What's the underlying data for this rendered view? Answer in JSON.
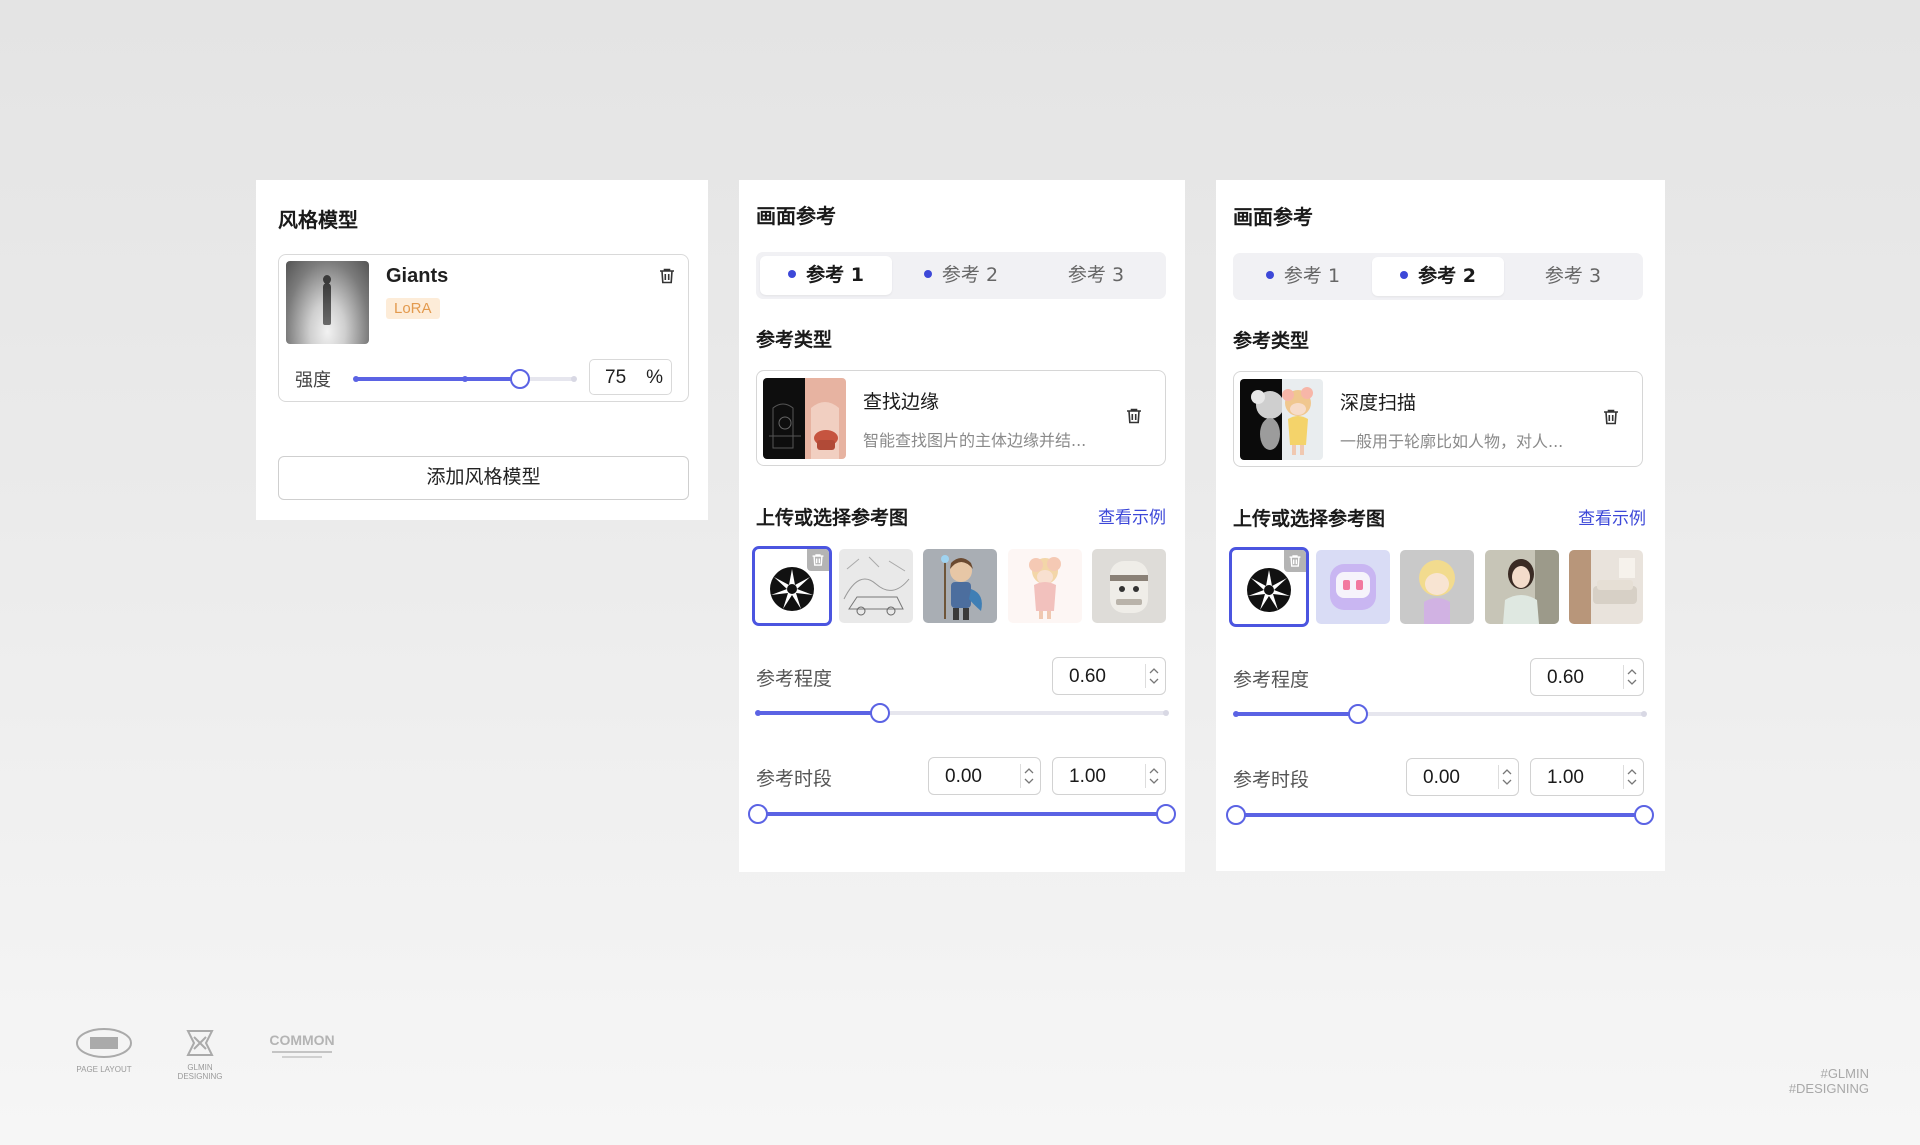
{
  "style_panel": {
    "title": "风格模型",
    "model": {
      "name": "Giants",
      "badge": "LoRA",
      "strength_label": "强度",
      "strength_value": "75",
      "strength_unit": "%",
      "strength_level": 0.75
    },
    "add_button": "添加风格模型"
  },
  "ref_panels": [
    {
      "title": "画面参考",
      "tabs": [
        "参考 1",
        "参考 2",
        "参考 3"
      ],
      "active_tab": 0,
      "type_section": "参考类型",
      "type": {
        "name": "查找边缘",
        "desc": "智能查找图片的主体边缘并结..."
      },
      "upload_section": "上传或选择参考图",
      "see_example": "查看示例",
      "strength_label": "参考程度",
      "strength_value": "0.60",
      "period_label": "参考时段",
      "period_start": "0.00",
      "period_end": "1.00"
    },
    {
      "title": "画面参考",
      "tabs": [
        "参考 1",
        "参考 2",
        "参考 3"
      ],
      "active_tab": 1,
      "type_section": "参考类型",
      "type": {
        "name": "深度扫描",
        "desc": "一般用于轮廓比如人物，对人..."
      },
      "upload_section": "上传或选择参考图",
      "see_example": "查看示例",
      "strength_label": "参考程度",
      "strength_value": "0.60",
      "period_label": "参考时段",
      "period_start": "0.00",
      "period_end": "1.00"
    }
  ],
  "footer": {
    "logo1_text": "PAGE LAYOUT",
    "logo2_text": "GLMIN DESIGNING",
    "logo3_text": "COMMON",
    "tag_line1": "#GLMIN",
    "tag_line2": "#DESIGNING"
  },
  "colors": {
    "accent": "#5b63e4",
    "link": "#3d48d8",
    "badge_bg": "#fdecd8",
    "badge_text": "#e39a4e"
  },
  "icons": {
    "delete": "trash-icon",
    "spinner": "chevron-up-down-icon"
  }
}
